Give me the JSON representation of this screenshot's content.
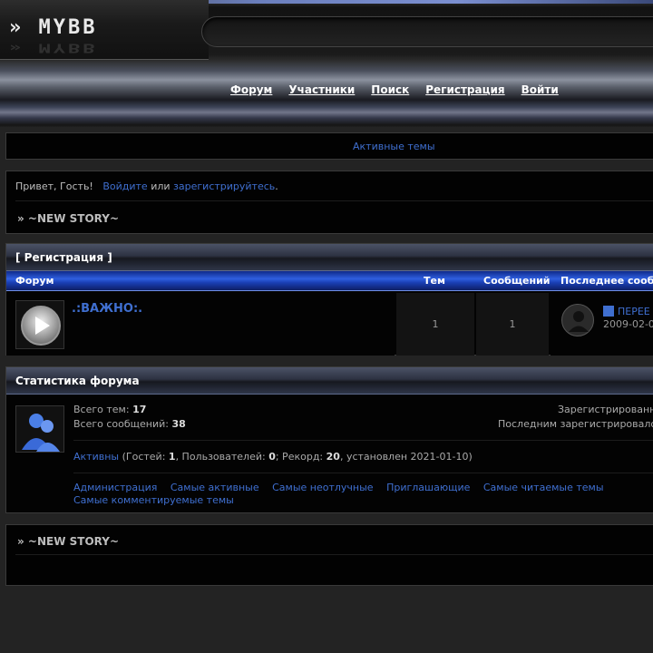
{
  "header": {
    "logo_text": "» MYBB",
    "nav": [
      "Форум",
      "Участники",
      "Поиск",
      "Регистрация",
      "Войти"
    ]
  },
  "active_bar": {
    "link": "Активные темы"
  },
  "welcome": {
    "greeting": "Привет, Гость!",
    "login_link": "Войдите",
    "or_text": "или",
    "register_link": "зарегистрируйтесь",
    "period": ".",
    "story_title": "» ~NEW STORY~"
  },
  "category": {
    "title": "[ Регистрация ]",
    "columns": {
      "forum": "Форум",
      "topics": "Тем",
      "posts": "Сообщений",
      "last_post": "Последнее сооб"
    },
    "forums": [
      {
        "name": ".:ВАЖНО:.",
        "topics": "1",
        "posts": "1",
        "last_post_title": "ПЕРЕЕ",
        "last_post_date": "2009-02-0"
      }
    ]
  },
  "stats": {
    "title": "Статистика форума",
    "topics_label": "Всего тем:",
    "topics_value": "17",
    "posts_label": "Всего сообщений:",
    "posts_value": "38",
    "registered_label": "Зарегистрированн",
    "last_registered_label": "Последним зарегистрировало",
    "online_link": "Активны",
    "guests_label": "(Гостей:",
    "guests_value": "1",
    "users_label": ", Пользователей:",
    "users_value": "0",
    "record_label": "; Рекорд:",
    "record_value": "20",
    "record_date": ", установлен 2021-01-10)",
    "links": [
      "Администрация",
      "Самые активные",
      "Самые неотлучные",
      "Приглашающие",
      "Самые читаемые темы",
      "Самые комментируемые темы"
    ]
  },
  "footer_story": {
    "title": "» ~NEW STORY~"
  },
  "colors": {
    "link": "#3f6fd0",
    "category_blue": "#2f5fe0",
    "background": "#232323"
  }
}
